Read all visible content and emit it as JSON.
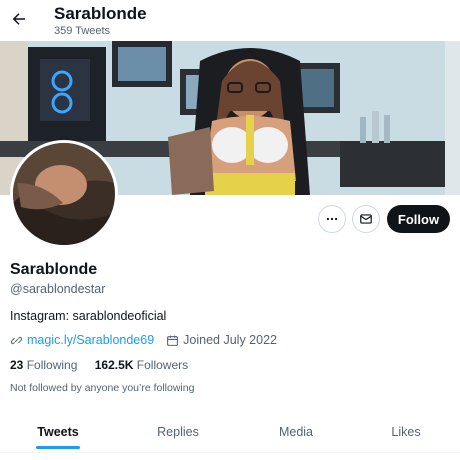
{
  "header": {
    "title": "Sarablonde",
    "tweet_count": "359 Tweets"
  },
  "profile": {
    "display_name": "Sarablonde",
    "handle": "@sarablondestar",
    "bio": "Instagram: sarablondeoficial",
    "website": "magic.ly/Sarablonde69",
    "joined": "Joined July 2022",
    "following_count": "23",
    "following_label": "Following",
    "followers_count": "162.5K",
    "followers_label": "Followers",
    "followed_by": "Not followed by anyone you’re following"
  },
  "actions": {
    "follow_label": "Follow"
  },
  "tabs": [
    {
      "label": "Tweets",
      "active": true
    },
    {
      "label": "Replies",
      "active": false
    },
    {
      "label": "Media",
      "active": false
    },
    {
      "label": "Likes",
      "active": false
    }
  ],
  "colors": {
    "accent": "#1d9bf0",
    "follow_button": "#0f1419",
    "muted_text": "#536471"
  },
  "icons": [
    "back-arrow-icon",
    "more-icon",
    "mail-icon",
    "link-icon",
    "calendar-icon"
  ]
}
